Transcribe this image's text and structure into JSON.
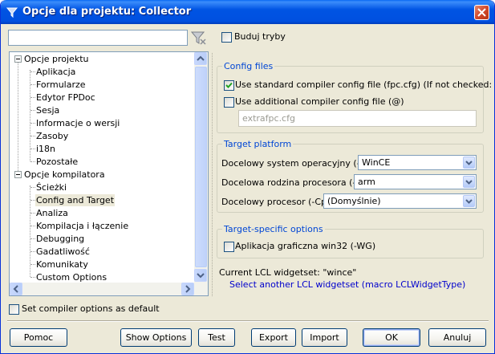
{
  "window": {
    "title": "Opcje dla projektu: Collector"
  },
  "filter": {
    "value": "",
    "placeholder": ""
  },
  "build_modes": {
    "label": "Buduj tryby",
    "checked": false
  },
  "tree": {
    "items": [
      {
        "label": "Opcje projektu",
        "level": 0
      },
      {
        "label": "Aplikacja",
        "level": 1
      },
      {
        "label": "Formularze",
        "level": 1
      },
      {
        "label": "Edytor FPDoc",
        "level": 1
      },
      {
        "label": "Sesja",
        "level": 1
      },
      {
        "label": "Informacje o wersji",
        "level": 1
      },
      {
        "label": "Zasoby",
        "level": 1
      },
      {
        "label": "i18n",
        "level": 1
      },
      {
        "label": "Pozostałe",
        "level": 1
      },
      {
        "label": "Opcje kompilatora",
        "level": 0
      },
      {
        "label": "Ścieżki",
        "level": 1
      },
      {
        "label": "Config and Target",
        "level": 1,
        "selected": true
      },
      {
        "label": "Analiza",
        "level": 1
      },
      {
        "label": "Kompilacja i łączenie",
        "level": 1
      },
      {
        "label": "Debugging",
        "level": 1
      },
      {
        "label": "Gadatliwość",
        "level": 1
      },
      {
        "label": "Komunikaty",
        "level": 1
      },
      {
        "label": "Custom Options",
        "level": 1
      }
    ]
  },
  "config_files": {
    "title": "Config files",
    "use_standard": {
      "label": "Use standard compiler config file (fpc.cfg) (If not checked: -n)",
      "checked": true
    },
    "use_additional": {
      "label": "Use additional compiler config file (@)",
      "checked": false
    },
    "additional_path": {
      "value": "extrafpc.cfg"
    }
  },
  "target_platform": {
    "title": "Target platform",
    "os": {
      "label": "Docelowy system operacyjny (-T)",
      "value": "WinCE"
    },
    "cpu_family": {
      "label": "Docelowa rodzina procesora (-P)",
      "value": "arm"
    },
    "cpu": {
      "label": "Docelowy procesor (-Cp)",
      "value": "(Domyślnie)"
    }
  },
  "target_specific": {
    "title": "Target-specific options",
    "win32_gui": {
      "label": "Aplikacja graficzna win32 (-WG)",
      "checked": false
    }
  },
  "lcl": {
    "current": "Current LCL widgetset: \"wince\"",
    "select_link": "Select another LCL widgetset (macro LCLWidgetType)"
  },
  "set_default": {
    "label": "Set compiler options as default",
    "checked": false
  },
  "buttons": {
    "help": "Pomoc",
    "show_options": "Show Options",
    "test": "Test",
    "export": "Export",
    "import": "Import",
    "ok": "OK",
    "cancel": "Anuluj"
  },
  "colors": {
    "titlebar": "#0054e3",
    "group_title": "#0046d5",
    "link": "#0000cc",
    "face": "#ece9d8"
  },
  "icons": {
    "title": "lazarus-icon",
    "filter": "funnel-clear-icon",
    "close": "close-icon",
    "check": "checkmark-icon",
    "combo": "chevron-down-icon"
  }
}
